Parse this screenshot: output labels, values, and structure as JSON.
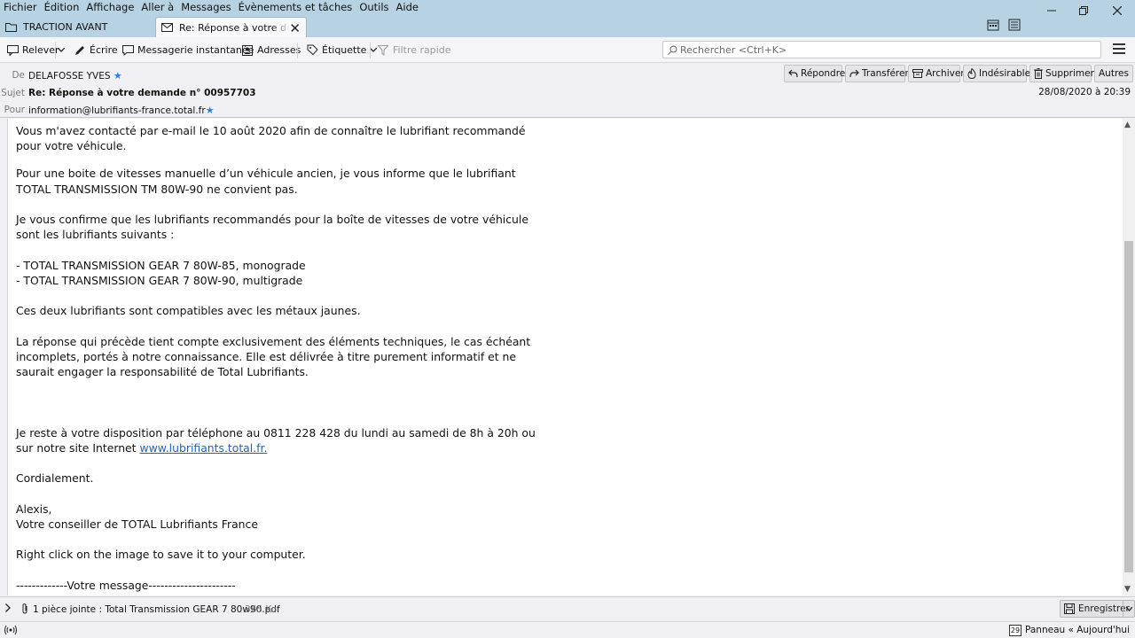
{
  "menubar": {
    "items": [
      "Fichier",
      "Édition",
      "Affichage",
      "Aller à",
      "Messages",
      "Évènements et tâches",
      "Outils",
      "Aide"
    ]
  },
  "tabs": [
    {
      "label": "TRACTION AVANT",
      "icon": "folder-icon",
      "active": false
    },
    {
      "label": "Re: Réponse à votre demande n° 00957703",
      "icon": "envelope-icon",
      "active": true
    }
  ],
  "toolbar": {
    "get_mail": "Relever",
    "write": "Écrire",
    "chat": "Messagerie instantanée",
    "address_book": "Adresses",
    "tag": "Étiquette",
    "quick_filter": "Filtre rapide",
    "search_placeholder": "Rechercher <Ctrl+K>"
  },
  "header": {
    "from_label": "De",
    "from_value": "DELAFOSSE YVES",
    "subject_label": "Sujet",
    "subject_value": "Re: Réponse à votre demande n° 00957703",
    "to_label": "Pour",
    "to_value": "information@lubrifiants-france.total.fr",
    "date": "28/08/2020 à 20:39",
    "actions": {
      "reply": "Répondre",
      "forward": "Transférer",
      "archive": "Archiver",
      "junk": "Indésirable",
      "delete": "Supprimer",
      "other": "Autres"
    }
  },
  "body": {
    "p1": "Vous m'avez contacté par e-mail le 10 août 2020 afin de connaître le lubrifiant recommandé pour votre véhicule.",
    "p2": "Pour une boite de vitesses manuelle d’un véhicule ancien, je vous informe que le lubrifiant TOTAL TRANSMISSION TM 80W-90 ne convient pas.",
    "p3": "Je vous confirme que les lubrifiants recommandés pour la boîte de vitesses de votre véhicule sont les lubrifiants suivants :",
    "li1": "- TOTAL TRANSMISSION GEAR 7 80W-85, monograde",
    "li2": "- TOTAL TRANSMISSION GEAR 7 80W-90, multigrade",
    "p4": "Ces deux lubrifiants sont compatibles avec les métaux jaunes.",
    "p5": "La réponse qui précède tient compte exclusivement des éléments techniques, le cas échéant incomplets, portés à notre connaissance. Elle est délivrée à titre purement informatif et ne saurait engager la responsabilité de Total Lubrifiants.",
    "p6_text": "Je reste à votre disposition par téléphone au 0811 228 428 du lundi au samedi de 8h à 20h ou sur notre site Internet ",
    "p6_link": "www.lubrifiants.total.fr.",
    "p7": "Cordialement.",
    "p8a": "Alexis,",
    "p8b": "Votre conseiller de TOTAL Lubrifiants France",
    "p9": "Right click on the image to save it to your computer.",
    "p10": "-------------Votre message----------------------"
  },
  "attachment": {
    "text": "1 pièce jointe : Total Transmission GEAR 7 80w90.pdf",
    "size": "365 Ko",
    "save_label": "Enregistrer"
  },
  "statusbar": {
    "panel": "Panneau « Aujourd'hui »",
    "day": "29"
  },
  "colors": {
    "titlebar": "#b7d3e3",
    "link": "#1f5fc9",
    "star": "#2f7de1"
  }
}
